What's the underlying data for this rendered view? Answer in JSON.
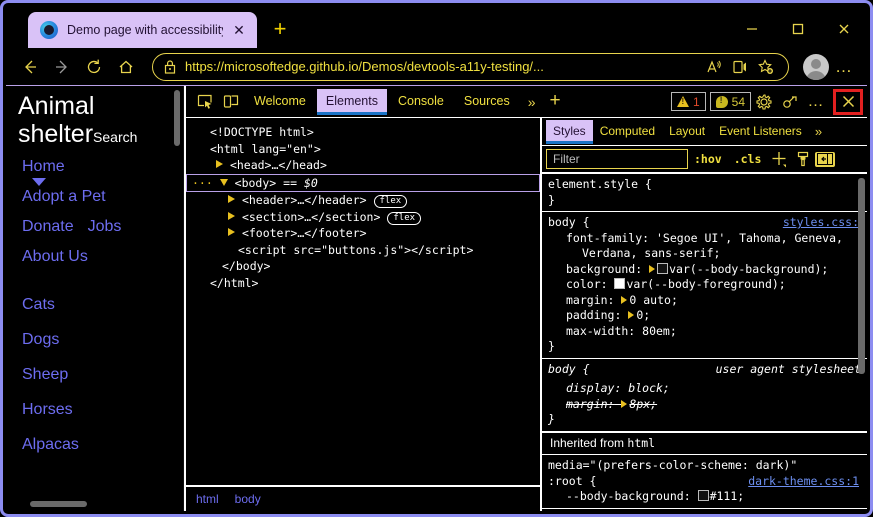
{
  "browser": {
    "tab": {
      "title": "Demo page with accessibility iss",
      "favicon_icon": "edge-logo-icon",
      "close_icon": "close-icon"
    },
    "new_tab_label": "+",
    "window_controls": {
      "minimize": "–",
      "maximize": "□",
      "close": "✕"
    },
    "nav": {
      "back_icon": "arrow-left-icon",
      "forward_icon": "arrow-right-icon",
      "reload_icon": "reload-icon",
      "home_icon": "home-icon"
    },
    "address": {
      "lock_icon": "lock-icon",
      "url": "https://microsoftedge.github.io/Demos/devtools-a11y-testing/...",
      "read_aloud_icon": "read-aloud-icon",
      "immersive_reader_icon": "immersive-reader-icon",
      "add_favorite_icon": "add-favorite-star-icon"
    },
    "profile_icon": "profile-avatar-icon",
    "settings_more_label": "…"
  },
  "page": {
    "site_title": "Animal shelter",
    "search_label": "Search",
    "nav_links": [
      "Home",
      "Adopt a Pet",
      "Donate",
      "Jobs",
      "About Us"
    ],
    "animal_links": [
      "Cats",
      "Dogs",
      "Sheep",
      "Horses",
      "Alpacas"
    ]
  },
  "devtools": {
    "toolbar": {
      "inspect_icon": "inspect-element-icon",
      "device_icon": "device-emulation-icon",
      "tabs": [
        {
          "label": "Welcome",
          "selected": false
        },
        {
          "label": "Elements",
          "selected": true
        },
        {
          "label": "Console",
          "selected": false
        },
        {
          "label": "Sources",
          "selected": false
        }
      ],
      "more_tabs_label": "»",
      "add_tab_label": "+",
      "warning_count": "1",
      "message_count": "54",
      "settings_icon": "gear-icon",
      "customize_icon": "customize-devtools-icon",
      "more_label": "…",
      "close_label": "✕"
    },
    "dom": {
      "lines": [
        "<!DOCTYPE html>",
        "<html lang=\"en\">",
        "<head>…</head>",
        "<body> == $0",
        "<header>…</header>",
        "<section>…</section>",
        "<footer>…</footer>",
        "<script src=\"buttons.js\"></script>",
        "</body>",
        "</html>"
      ],
      "doctype": "<!DOCTYPE html>",
      "html_open": "<html lang=\"en\">",
      "head": "<head>…</head>",
      "body_sel": "<body>",
      "body_eq": "==",
      "body_dollar": "$0",
      "header": "<header>…</header>",
      "section": "<section>…</section>",
      "footer": "<footer>…</footer>",
      "script": "<script src=\"buttons.js\"></script>",
      "body_close": "</body>",
      "html_close": "</html>",
      "flex_badge": "flex",
      "breadcrumb": [
        "html",
        "body"
      ]
    },
    "styles": {
      "tabs": [
        {
          "label": "Styles",
          "selected": true
        },
        {
          "label": "Computed",
          "selected": false
        },
        {
          "label": "Layout",
          "selected": false
        },
        {
          "label": "Event Listeners",
          "selected": false
        }
      ],
      "more_tabs_label": "»",
      "filter_placeholder": "Filter",
      "hov_label": ":hov",
      "cls_label": ".cls",
      "new_rule_label": "+",
      "pen_icon": "style-pen-icon",
      "sidebar_toggle_icon": "toggle-sidebar-icon",
      "rules": {
        "element_style_open": "element.style {",
        "element_style_close": "}",
        "body_open": "body {",
        "body_src": "styles.css:",
        "d_font_family_1": "font-family: 'Segoe UI', Tahoma, Geneva,",
        "d_font_family_2": "Verdana, sans-serif;",
        "d_background_name": "background:",
        "d_background_val": "var(--body-background);",
        "d_color_name": "color:",
        "d_color_val": "var(--body-foreground);",
        "d_margin": "margin:",
        "d_margin_val": "0 auto;",
        "d_padding": "padding:",
        "d_padding_val": "0;",
        "d_maxwidth": "max-width: 80em;",
        "body_close": "}",
        "ua_body_open": "body {",
        "ua_label": "user agent stylesheet",
        "ua_display": "display: block;",
        "ua_margin": "margin:",
        "ua_margin_val": "8px;",
        "ua_close": "}",
        "inherited_text": "Inherited from",
        "inherited_node": "html",
        "media_query": "media=\"(prefers-color-scheme: dark)\"",
        "root_open": ":root {",
        "root_src": "dark-theme.css:1",
        "root_decl_name": "--body-background:",
        "root_decl_val": "#111;"
      }
    }
  }
}
